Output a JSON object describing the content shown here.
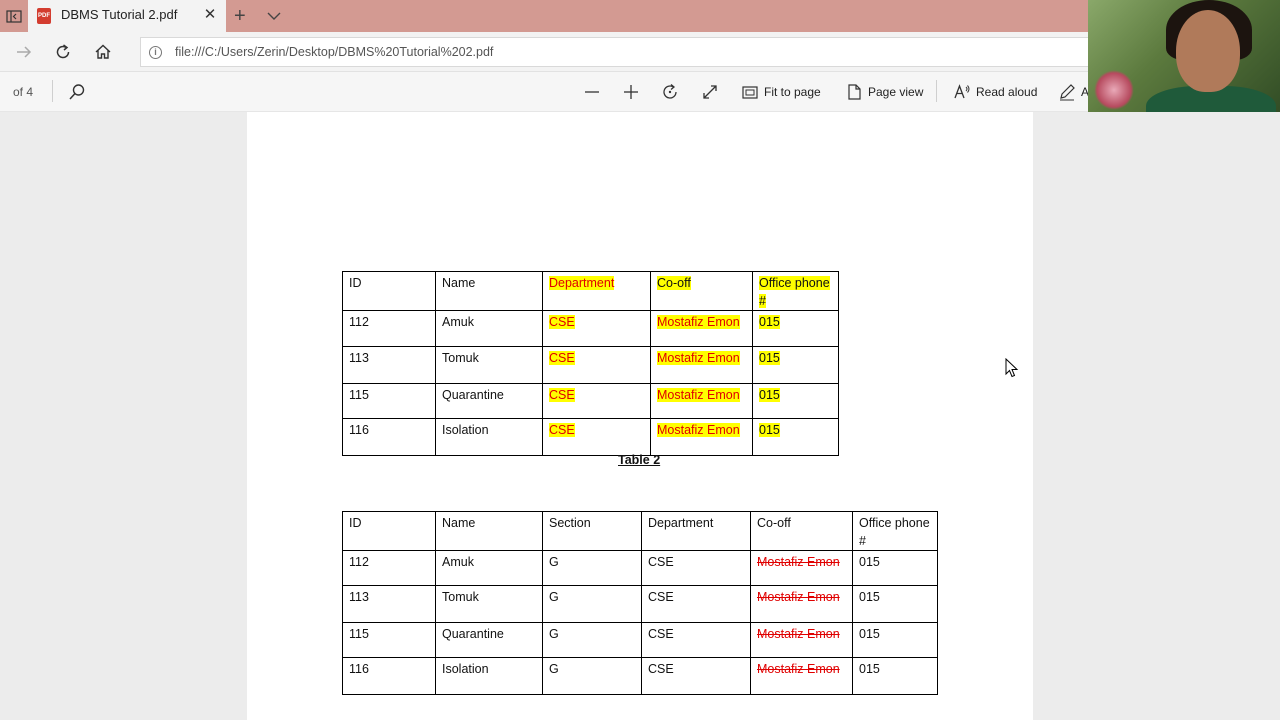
{
  "browser": {
    "tab_title": "DBMS Tutorial 2.pdf",
    "url": "file:///C:/Users/Zerin/Desktop/DBMS%20Tutorial%202.pdf"
  },
  "pdf_toolbar": {
    "page_count": "of 4",
    "fit_label": "Fit to page",
    "page_view_label": "Page view",
    "read_aloud_label": "Read aloud",
    "truncated_label": "A"
  },
  "table2": {
    "headers": [
      "ID",
      "Name",
      "Department",
      "Co-off",
      "Office phone #"
    ],
    "rows": [
      [
        "112",
        "Amuk",
        "CSE",
        "Mostafiz Emon",
        "015"
      ],
      [
        "113",
        "Tomuk",
        "CSE",
        "Mostafiz Emon",
        "015"
      ],
      [
        "115",
        "Quarantine",
        "CSE",
        "Mostafiz Emon",
        "015"
      ],
      [
        "116",
        "Isolation",
        "CSE",
        "Mostafiz Emon",
        "015"
      ]
    ],
    "caption": "Table 2"
  },
  "table3": {
    "headers": [
      "ID",
      "Name",
      "Section",
      "Department",
      "Co-off",
      "Office phone #"
    ],
    "rows": [
      [
        "112",
        "Amuk",
        "G",
        "CSE",
        "Mostafiz Emon",
        "015"
      ],
      [
        "113",
        "Tomuk",
        "G",
        "CSE",
        "Mostafiz Emon",
        "015"
      ],
      [
        "115",
        "Quarantine",
        "G",
        "CSE",
        "Mostafiz Emon",
        "015"
      ],
      [
        "116",
        "Isolation",
        "G",
        "CSE",
        "Mostafiz Emon",
        "015"
      ]
    ]
  }
}
